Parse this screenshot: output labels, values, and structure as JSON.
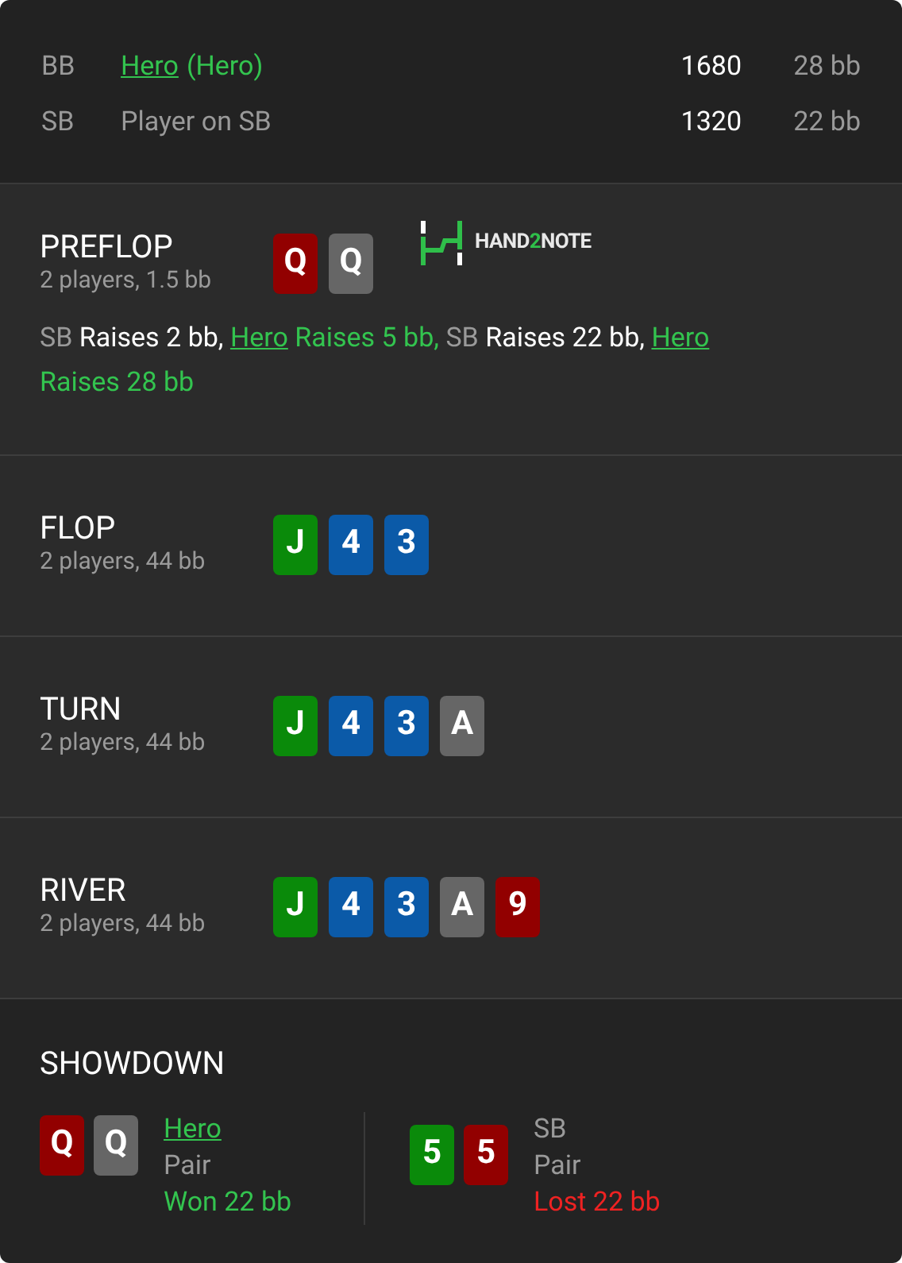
{
  "players": [
    {
      "position": "BB",
      "name": "Hero",
      "alias": "(Hero)",
      "hero": true,
      "chips": "1680",
      "stack": "28 bb"
    },
    {
      "position": "SB",
      "name": "Player on SB",
      "hero": false,
      "chips": "1320",
      "stack": "22 bb"
    }
  ],
  "streets": [
    {
      "name": "PREFLOP",
      "info": "2 players, 1.5 bb",
      "cards": [
        {
          "rank": "Q",
          "color": "#920000"
        },
        {
          "rank": "Q",
          "color": "#666666"
        }
      ],
      "logo": {
        "left": "HAND",
        "accent": "2",
        "right": "NOTE"
      },
      "actions": [
        {
          "player": "SB",
          "hero": false,
          "action": "Raises 2 bb,"
        },
        {
          "player": "Hero",
          "hero": true,
          "action": "Raises 5 bb,"
        },
        {
          "player": "SB",
          "hero": false,
          "action": "Raises 22 bb,"
        },
        {
          "player": "Hero",
          "hero": true,
          "action": "Raises 28 bb"
        }
      ]
    },
    {
      "name": "FLOP",
      "info": "2 players, 44 bb",
      "cards": [
        {
          "rank": "J",
          "color": "#0a8a0a"
        },
        {
          "rank": "4",
          "color": "#0b5aa8"
        },
        {
          "rank": "3",
          "color": "#0b5aa8"
        }
      ]
    },
    {
      "name": "TURN",
      "info": "2 players, 44 bb",
      "cards": [
        {
          "rank": "J",
          "color": "#0a8a0a"
        },
        {
          "rank": "4",
          "color": "#0b5aa8"
        },
        {
          "rank": "3",
          "color": "#0b5aa8"
        },
        {
          "rank": "A",
          "color": "#666666"
        }
      ]
    },
    {
      "name": "RIVER",
      "info": "2 players, 44 bb",
      "cards": [
        {
          "rank": "J",
          "color": "#0a8a0a"
        },
        {
          "rank": "4",
          "color": "#0b5aa8"
        },
        {
          "rank": "3",
          "color": "#0b5aa8"
        },
        {
          "rank": "A",
          "color": "#666666"
        },
        {
          "rank": "9",
          "color": "#920000"
        }
      ]
    }
  ],
  "showdown": {
    "title": "SHOWDOWN",
    "hands": [
      {
        "player": "Hero",
        "hero": true,
        "hand": "Pair",
        "result": "Won 22 bb",
        "won": true,
        "cards": [
          {
            "rank": "Q",
            "color": "#920000"
          },
          {
            "rank": "Q",
            "color": "#666666"
          }
        ]
      },
      {
        "player": "SB",
        "hero": false,
        "hand": "Pair",
        "result": "Lost 22 bb",
        "won": false,
        "cards": [
          {
            "rank": "5",
            "color": "#0a8a0a"
          },
          {
            "rank": "5",
            "color": "#920000"
          }
        ]
      }
    ]
  }
}
